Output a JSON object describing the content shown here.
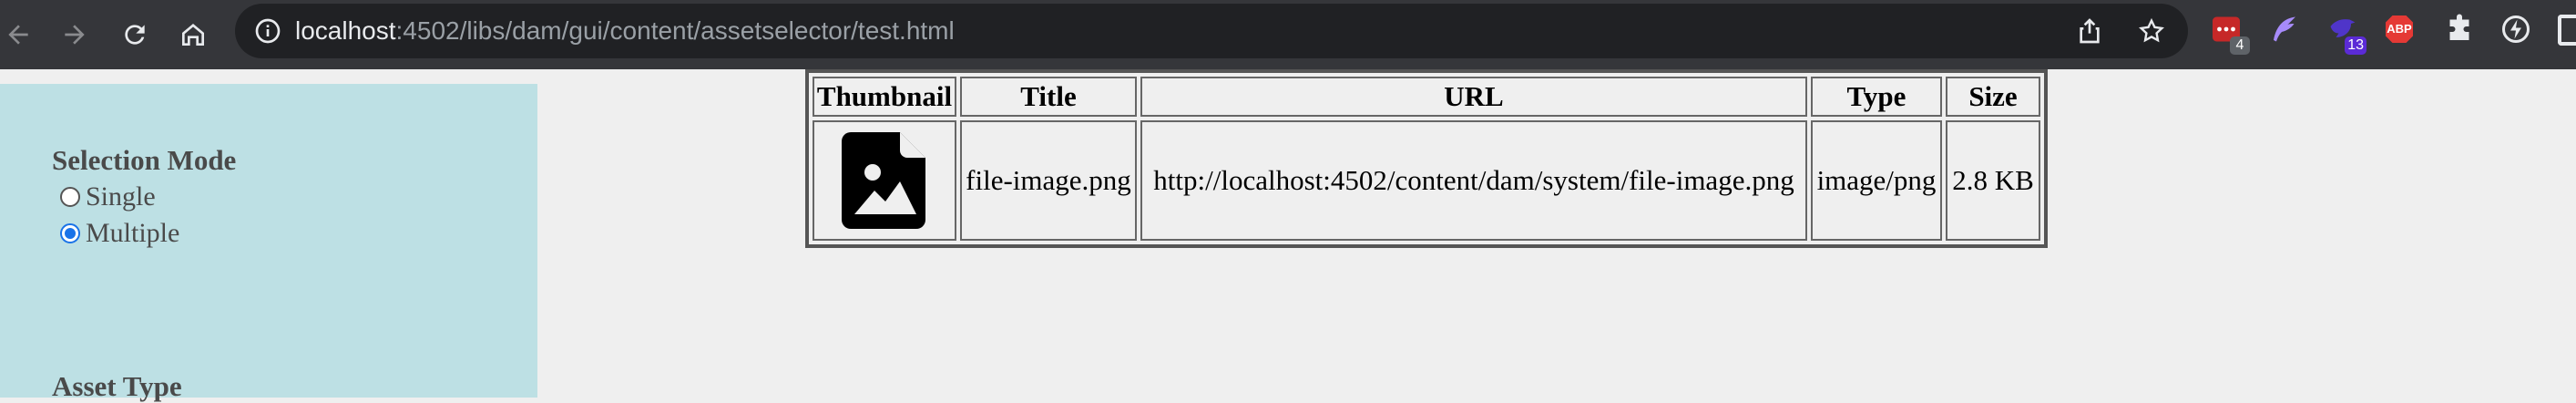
{
  "browser": {
    "url_host": "localhost",
    "url_path": ":4502/libs/dam/gui/content/assetselector/test.html",
    "extensions": [
      {
        "name": "todo-extension-icon",
        "badge": "4",
        "badge_color": "#5f6368"
      },
      {
        "name": "feather-extension-icon"
      },
      {
        "name": "bird-extension-icon",
        "badge": "13",
        "badge_color": "#5b2bd6"
      },
      {
        "name": "adblock-plus-icon",
        "text": "ABP"
      },
      {
        "name": "puzzle-extensions-icon"
      },
      {
        "name": "performance-icon"
      }
    ]
  },
  "sidebar": {
    "selection_mode": {
      "title": "Selection Mode",
      "options": [
        {
          "label": "Single",
          "checked": false
        },
        {
          "label": "Multiple",
          "checked": true
        }
      ]
    },
    "asset_type": {
      "title": "Asset Type"
    }
  },
  "table": {
    "headers": [
      "Thumbnail",
      "Title",
      "URL",
      "Type",
      "Size"
    ],
    "rows": [
      {
        "thumbnail_icon": "image-file-icon",
        "title": "file-image.png",
        "url": "http://localhost:4502/content/dam/system/file-image.png",
        "type": "image/png",
        "size": "2.8 KB"
      }
    ]
  }
}
